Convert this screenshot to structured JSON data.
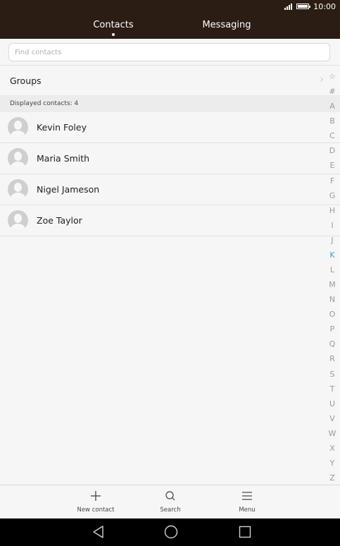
{
  "status_bar": {
    "time": "10:00"
  },
  "tabs": [
    {
      "label": "Contacts",
      "active": true
    },
    {
      "label": "Messaging",
      "active": false
    }
  ],
  "search": {
    "placeholder": "Find contacts"
  },
  "groups": {
    "label": "Groups"
  },
  "count_text": "Displayed contacts:  4",
  "contacts": [
    {
      "name": "Kevin Foley"
    },
    {
      "name": "Maria Smith"
    },
    {
      "name": "Nigel Jameson"
    },
    {
      "name": "Zoe Taylor"
    }
  ],
  "alpha_index": [
    "☆",
    "#",
    "A",
    "B",
    "C",
    "D",
    "E",
    "F",
    "G",
    "H",
    "I",
    "J",
    "K",
    "L",
    "M",
    "N",
    "O",
    "P",
    "Q",
    "R",
    "S",
    "T",
    "U",
    "V",
    "W",
    "X",
    "Y",
    "Z"
  ],
  "alpha_active": "K",
  "toolbar": {
    "new_contact": "New contact",
    "search": "Search",
    "menu": "Menu"
  },
  "colors": {
    "header_bg": "#2b1d14",
    "accent": "#2aa6c8"
  },
  "icons": {
    "new_contact": "plus-icon",
    "search": "search-icon",
    "menu": "menu-icon",
    "back": "back-triangle-icon",
    "home": "home-circle-icon",
    "recent": "recent-square-icon"
  }
}
